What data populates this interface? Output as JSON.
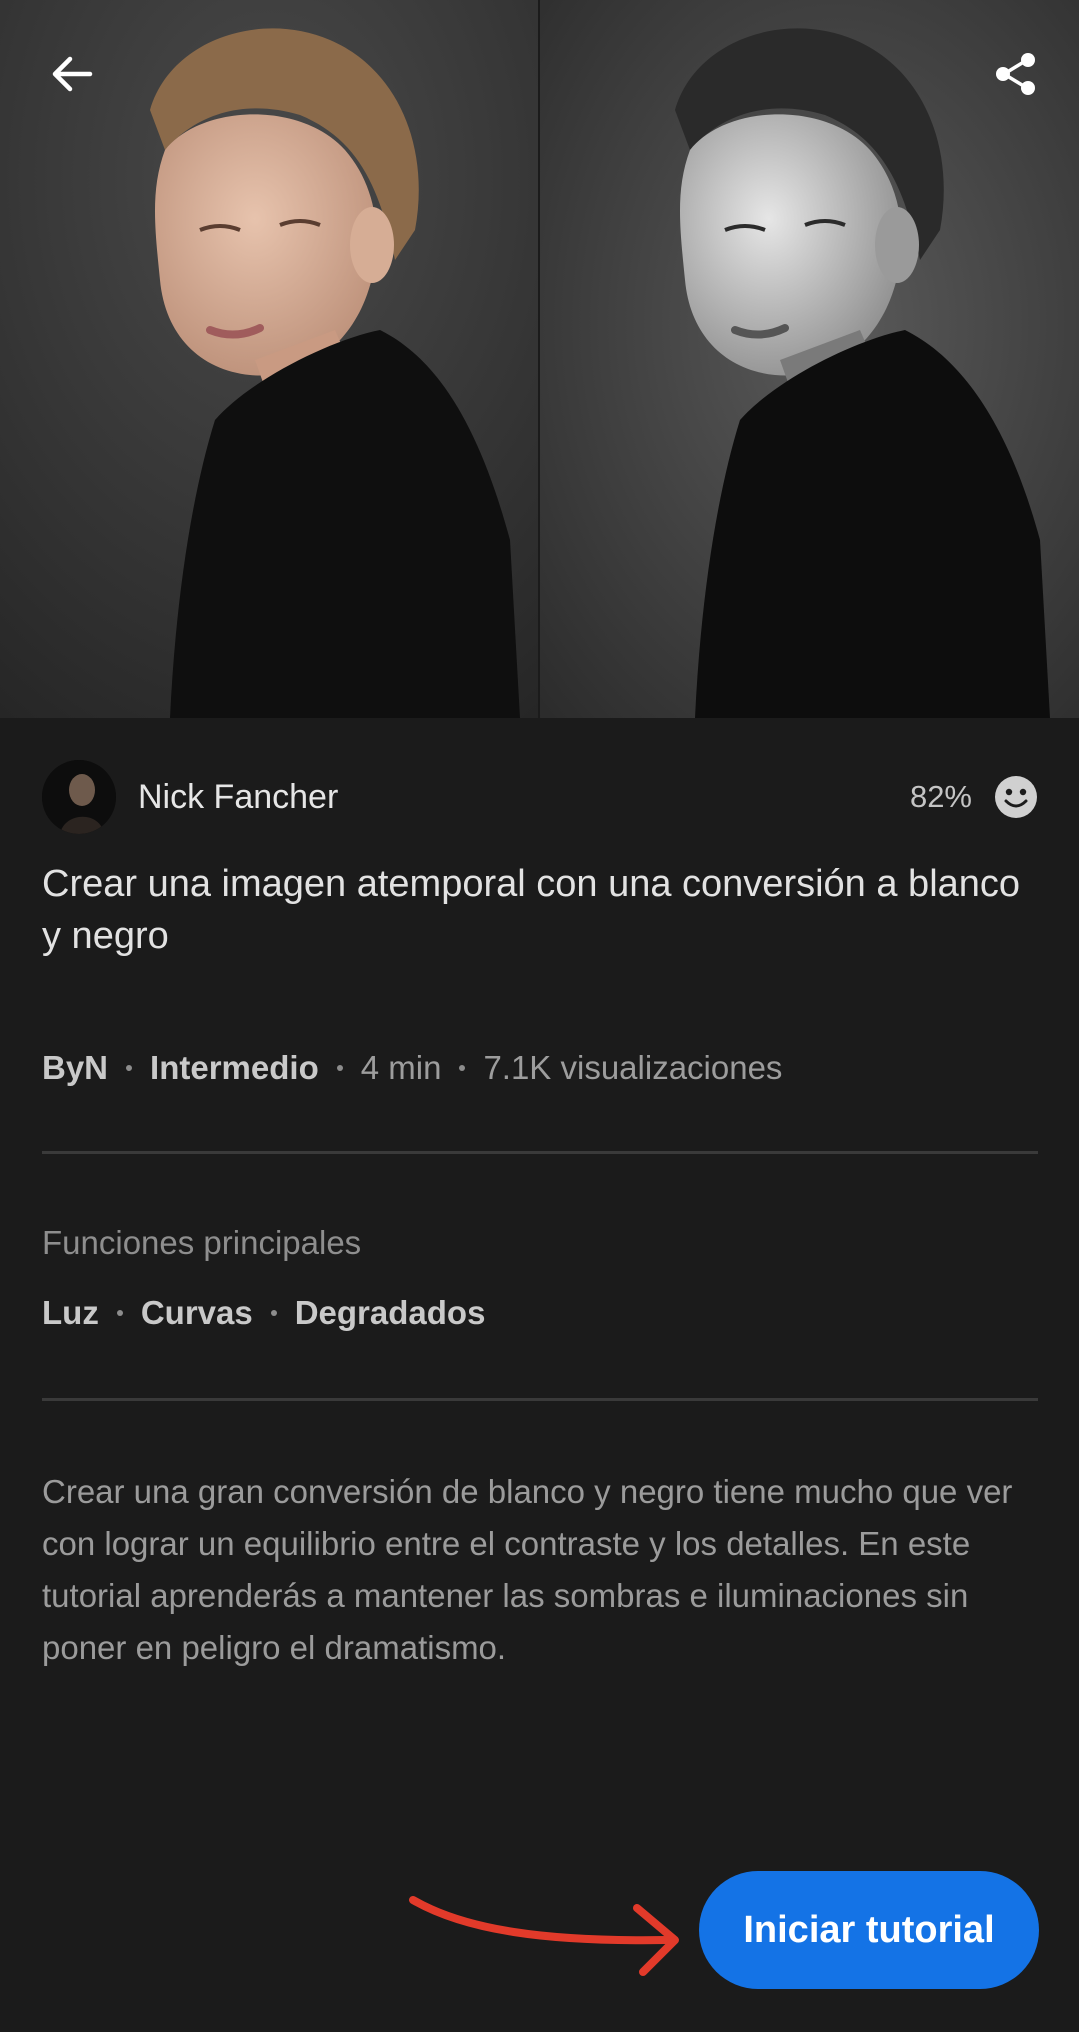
{
  "author": {
    "name": "Nick Fancher",
    "rating": "82%"
  },
  "tutorial": {
    "title": "Crear una imagen atemporal con una conversión a blanco y negro",
    "meta": {
      "category": "ByN",
      "level": "Intermedio",
      "duration": "4 min",
      "views": "7.1K visualizaciones"
    },
    "features_label": "Funciones principales",
    "features": [
      "Luz",
      "Curvas",
      "Degradados"
    ],
    "description": "Crear una gran conversión de blanco y negro tiene mucho que ver con lograr un equilibrio entre el contraste y los detalles. En este tutorial aprenderás a mantener las sombras e iluminaciones sin poner en peligro el dramatismo."
  },
  "actions": {
    "start_label": "Iniciar tutorial"
  },
  "icons": {
    "back": "arrow-left-icon",
    "share": "share-icon",
    "rating": "smiley-icon"
  },
  "colors": {
    "background": "#1b1b1b",
    "accent": "#1473e6",
    "annotation": "#e23a2a"
  }
}
